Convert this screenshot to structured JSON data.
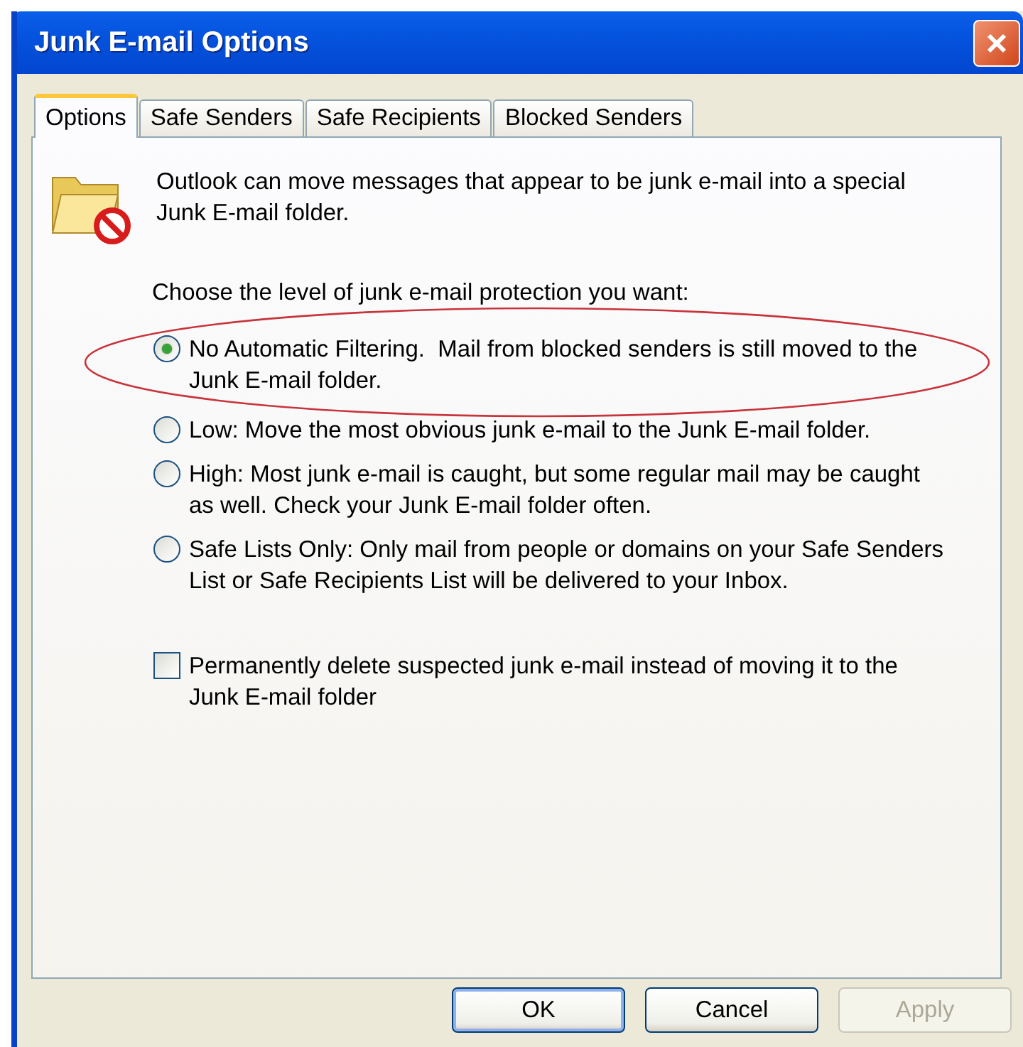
{
  "window": {
    "title": "Junk E-mail Options"
  },
  "tabs": [
    {
      "label": "Options",
      "selected": true
    },
    {
      "label": "Safe Senders",
      "selected": false
    },
    {
      "label": "Safe Recipients",
      "selected": false
    },
    {
      "label": "Blocked Senders",
      "selected": false
    }
  ],
  "intro": "Outlook can move messages that appear to be junk e-mail into a special Junk E-mail folder.",
  "prompt": "Choose the level of junk e-mail protection you want:",
  "levels": [
    {
      "label": "No Automatic Filtering.  Mail from blocked senders is still moved to the Junk E-mail folder.",
      "selected": true,
      "circled": true
    },
    {
      "label": "Low: Move the most obvious junk e-mail to the Junk E-mail folder.",
      "selected": false,
      "circled": false
    },
    {
      "label": "High: Most junk e-mail is caught, but some regular mail may be caught as well. Check your Junk E-mail folder often.",
      "selected": false,
      "circled": false
    },
    {
      "label": "Safe Lists Only: Only mail from people or domains on your Safe Senders List or Safe Recipients List will be delivered to your Inbox.",
      "selected": false,
      "circled": false
    }
  ],
  "delete_option": {
    "label": "Permanently delete suspected junk e-mail instead of moving it to the Junk E-mail folder",
    "checked": false
  },
  "buttons": [
    {
      "label": "OK",
      "kind": "default",
      "disabled": false
    },
    {
      "label": "Cancel",
      "kind": "normal",
      "disabled": false
    },
    {
      "label": "Apply",
      "kind": "normal",
      "disabled": true
    }
  ]
}
